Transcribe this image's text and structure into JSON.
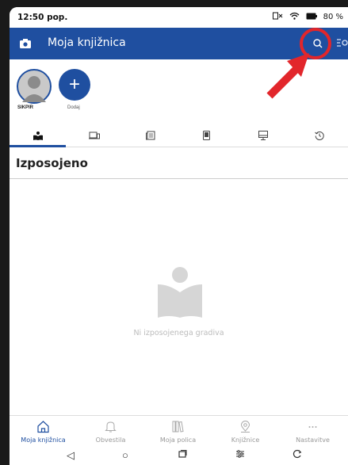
{
  "status": {
    "time": "12:50 pop.",
    "battery": "80 %"
  },
  "appbar": {
    "title": "Moja knjižnica"
  },
  "avatars": [
    {
      "label": "SIKPIR"
    },
    {
      "label": "Dodaj",
      "symbol": "+"
    }
  ],
  "section": {
    "title": "Izposojeno"
  },
  "empty": {
    "message": "Ni izposojenega gradiva"
  },
  "bottom_nav": [
    {
      "label": "Moja knjižnica"
    },
    {
      "label": "Obvestila"
    },
    {
      "label": "Moja polica"
    },
    {
      "label": "Knjižnice"
    },
    {
      "label": "Nastavitve"
    }
  ],
  "colors": {
    "accent": "#1f4fa0",
    "highlight": "#e2262b"
  }
}
